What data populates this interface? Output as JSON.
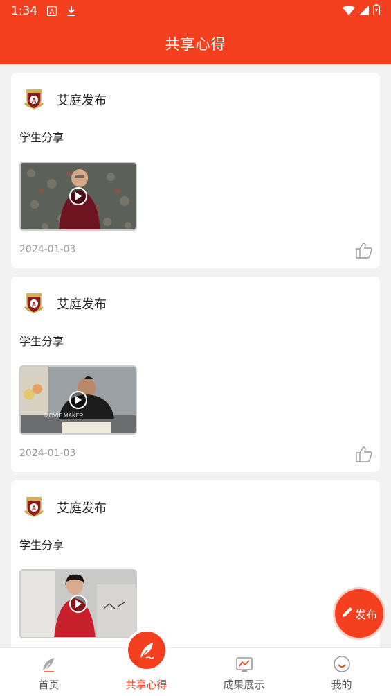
{
  "status": {
    "time": "1:34",
    "icons": [
      "a-icon",
      "download-icon",
      "wifi-icon",
      "signal-icon",
      "battery-icon"
    ]
  },
  "header": {
    "title": "共享心得"
  },
  "posts": [
    {
      "author": "艾庭发布",
      "text": "学生分享",
      "date": "2024-01-03",
      "video": "boy-standing-floral-wall"
    },
    {
      "author": "艾庭发布",
      "text": "学生分享",
      "date": "2024-01-03",
      "video": "boy-writing-at-desk"
    },
    {
      "author": "艾庭发布",
      "text": "学生分享",
      "date": "",
      "video": "girl-standing-room"
    }
  ],
  "fab": {
    "label": "发布"
  },
  "tabs": [
    {
      "label": "首页",
      "icon": "feather-icon"
    },
    {
      "label": "共享心得",
      "icon": "quill-icon",
      "active": true
    },
    {
      "label": "成果展示",
      "icon": "chart-icon"
    },
    {
      "label": "我的",
      "icon": "smile-icon"
    }
  ],
  "thumb_text": {
    "movie_maker": "MOVIE MAKER"
  },
  "colors": {
    "brand": "#f4401f",
    "card": "#ffffff",
    "background": "#f2f2f2"
  }
}
